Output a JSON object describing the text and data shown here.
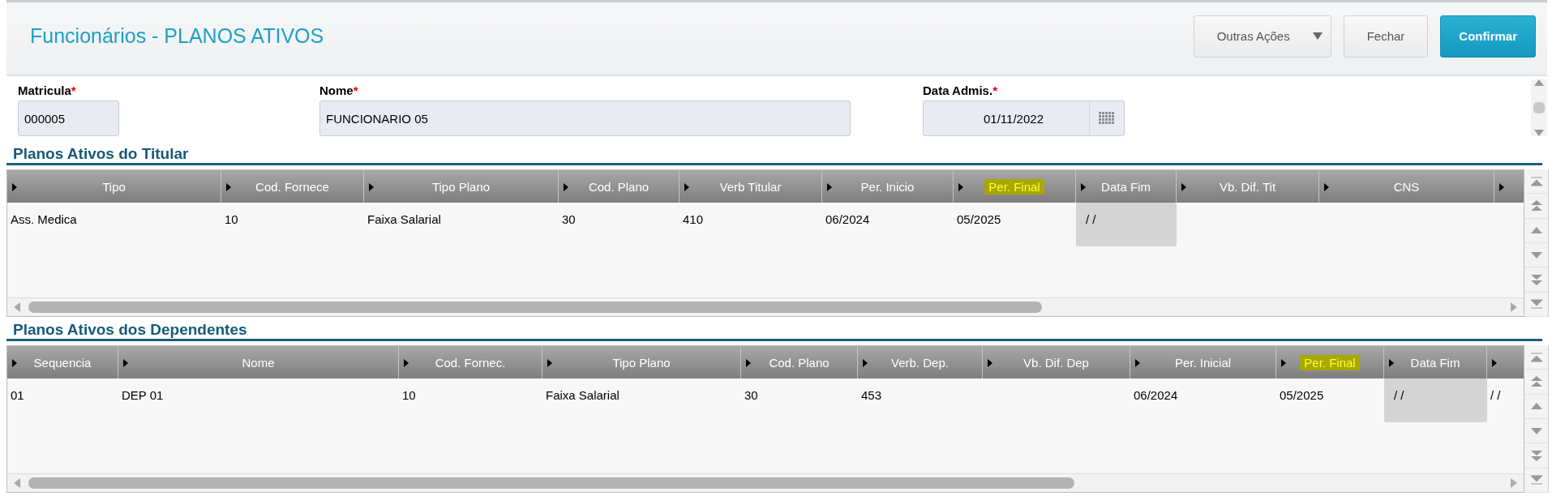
{
  "window": {
    "title": "Funcionários - PLANOS ATIVOS"
  },
  "buttons": [
    {
      "label": "Outras Ações",
      "kind": "dropdown"
    },
    {
      "label": "Fechar",
      "kind": "secondary"
    },
    {
      "label": "Confirmar",
      "kind": "primary"
    }
  ],
  "fields": [
    {
      "label": "Matricula",
      "required_mark": "*",
      "value": "000005",
      "kind": "text"
    },
    {
      "label": "Nome",
      "required_mark": "*",
      "value": "FUNCIONARIO 05",
      "kind": "text"
    },
    {
      "label": "Data Admis.",
      "required_mark": "*",
      "value": "01/11/2022",
      "kind": "date"
    }
  ],
  "grids": [
    {
      "title": "Planos Ativos do Titular",
      "columns": [
        {
          "label": "Tipo",
          "highlighted": false
        },
        {
          "label": "Cod. Fornece",
          "highlighted": false
        },
        {
          "label": "Tipo Plano",
          "highlighted": false
        },
        {
          "label": "Cod. Plano",
          "highlighted": false
        },
        {
          "label": "Verb Titular",
          "highlighted": false
        },
        {
          "label": "Per. Inicio",
          "highlighted": false
        },
        {
          "label": "Per. Final",
          "highlighted": true
        },
        {
          "label": "Data Fim",
          "highlighted": false
        },
        {
          "label": "Vb. Dif. Tit",
          "highlighted": false
        },
        {
          "label": "CNS",
          "highlighted": false
        }
      ],
      "rows": [
        {
          "cells": [
            {
              "text": "Ass. Medica",
              "shaded": false
            },
            {
              "text": "10",
              "shaded": false
            },
            {
              "text": "Faixa Salarial",
              "shaded": false
            },
            {
              "text": "30",
              "shaded": false
            },
            {
              "text": "410",
              "shaded": false
            },
            {
              "text": "06/2024",
              "shaded": false
            },
            {
              "text": "05/2025",
              "shaded": false
            },
            {
              "text": "/ /",
              "shaded": true
            }
          ]
        }
      ]
    },
    {
      "title": "Planos Ativos dos Dependentes",
      "columns": [
        {
          "label": "Sequencia",
          "highlighted": false
        },
        {
          "label": "Nome",
          "highlighted": false
        },
        {
          "label": "Cod. Fornec.",
          "highlighted": false
        },
        {
          "label": "Tipo Plano",
          "highlighted": false
        },
        {
          "label": "Cod. Plano",
          "highlighted": false
        },
        {
          "label": "Verb. Dep.",
          "highlighted": false
        },
        {
          "label": "Vb. Dif. Dep",
          "highlighted": false
        },
        {
          "label": "Per. Inicial",
          "highlighted": false
        },
        {
          "label": "Per. Final",
          "highlighted": true
        },
        {
          "label": "Data Fim",
          "highlighted": false
        }
      ],
      "rows": [
        {
          "cells": [
            {
              "text": "01",
              "shaded": false
            },
            {
              "text": "DEP 01",
              "shaded": false
            },
            {
              "text": "10",
              "shaded": false
            },
            {
              "text": "Faixa Salarial",
              "shaded": false
            },
            {
              "text": "30",
              "shaded": false
            },
            {
              "text": "453",
              "shaded": false
            },
            null,
            {
              "text": "06/2024",
              "shaded": false
            },
            {
              "text": "05/2025",
              "shaded": false
            },
            {
              "text": "/ /",
              "shaded": true
            },
            {
              "text": "/ /",
              "shaded": false
            }
          ]
        }
      ]
    }
  ]
}
